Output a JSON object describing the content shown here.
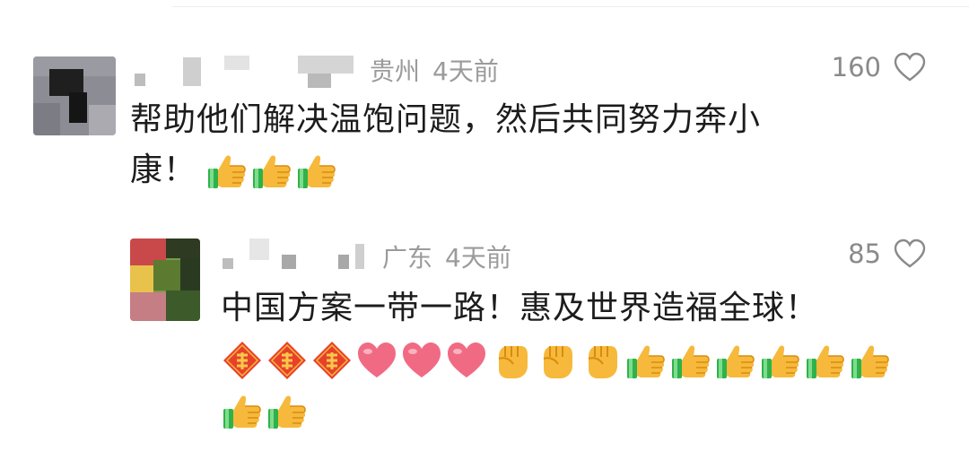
{
  "comments": [
    {
      "location": "贵州",
      "time": "4天前",
      "likes": "160",
      "text_lines": [
        "帮助他们解决温饱问题，然后共同努力奔小",
        "康！"
      ],
      "emoji_rows": [
        [
          "thumbs-up-icon",
          "thumbs-up-icon",
          "thumbs-up-icon"
        ]
      ]
    },
    {
      "location": "广东",
      "time": "4天前",
      "likes": "85",
      "text_lines": [
        "中国方案一带一路！惠及世界造福全球！"
      ],
      "emoji_rows": [
        [
          "fu-diamond-icon",
          "fu-diamond-icon",
          "fu-diamond-icon",
          "heart-emoji-icon",
          "heart-emoji-icon",
          "heart-emoji-icon",
          "raised-fist-icon",
          "raised-fist-icon",
          "raised-fist-icon",
          "thumbs-up-icon",
          "thumbs-up-icon",
          "thumbs-up-icon",
          "thumbs-up-icon",
          "thumbs-up-icon",
          "thumbs-up-icon"
        ],
        [
          "thumbs-up-icon",
          "thumbs-up-icon"
        ]
      ]
    }
  ],
  "colors": {
    "meta": "#9b9b9b",
    "text": "#1c1c1c",
    "thumb": "#f5b731",
    "heart": "#f0607a",
    "fu": "#e8412b"
  }
}
